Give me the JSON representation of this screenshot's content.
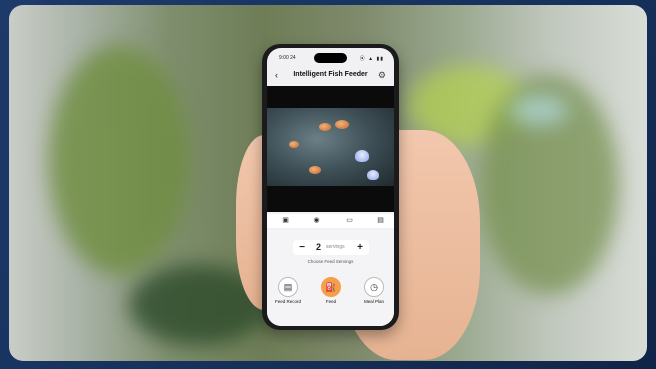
{
  "status": {
    "time": "9:00 24",
    "icons": "⦿ ▲ ▮▮"
  },
  "header": {
    "title": "Intelligent Fish Feeder",
    "back_icon": "chevron-left-icon",
    "settings_icon": "gear-icon"
  },
  "toolbar": {
    "icons": [
      "image-icon",
      "camera-icon",
      "video-icon",
      "screen-icon"
    ]
  },
  "feeding": {
    "count": "2",
    "unit": "servings",
    "hint": "Choose Feed Servings"
  },
  "actions": [
    {
      "label": "Feed Record",
      "icon": "document-icon"
    },
    {
      "label": "Feed",
      "icon": "fish-feed-icon"
    },
    {
      "label": "Meal Plan",
      "icon": "clock-icon"
    }
  ],
  "colors": {
    "accent": "#f4a04a",
    "background": "#1f3a66"
  }
}
